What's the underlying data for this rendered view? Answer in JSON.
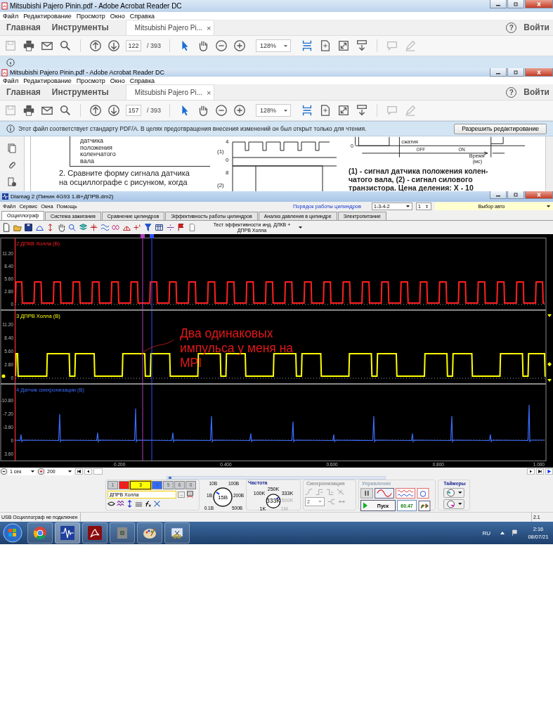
{
  "acrobat_windows": [
    {
      "title": "Mitsubishi Pajero Pinin.pdf - Adobe Acrobat Reader DC",
      "menu": [
        "Файл",
        "Редактирование",
        "Просмотр",
        "Окно",
        "Справка"
      ],
      "nav_tabs": [
        "Главная",
        "Инструменты"
      ],
      "document_tab": "Mitsubishi Pajero Pi...",
      "close_tab": "×",
      "help": "?",
      "sign_in": "Войти",
      "page": "122",
      "page_total": "/ 393",
      "zoom": "128%"
    },
    {
      "title": "Mitsubishi Pajero Pinin.pdf - Adobe Acrobat Reader DC",
      "menu": [
        "Файл",
        "Редактирование",
        "Просмотр",
        "Окно",
        "Справка"
      ],
      "nav_tabs": [
        "Главная",
        "Инструменты"
      ],
      "document_tab": "Mitsubishi Pajero Pi...",
      "close_tab": "×",
      "help": "?",
      "sign_in": "Войти",
      "page": "157",
      "page_total": "/ 393",
      "zoom": "128%",
      "info_bar": {
        "text": "Этот файл соответствует стандарту PDF/A. В целях предотвращения внесения изменений он был открыт только для чтения.",
        "button": "Разрешить редактирование"
      },
      "document": {
        "callout": [
          "датчика",
          "положения",
          "коленчатого",
          "вала"
        ],
        "paragraph": [
          "2. Сравните форму сигнала датчика",
          "на осциллографе с рисунком, когда"
        ],
        "middle_labels": [
          "4",
          "(1)",
          "0",
          "8",
          "(2)"
        ],
        "right_labels": {
          "compression": "сжатия",
          "zero": "0",
          "off": "OFF",
          "on": "ON",
          "axis_title": "Время",
          "axis_unit": "(мс)"
        },
        "caption": [
          "(1) - сигнал датчика положения колен-",
          "чатого вала, (2) - сигнал силового",
          "транзистора. Цена деления: X - 10"
        ]
      }
    }
  ],
  "diamag": {
    "title": "Diamag 2 (Пинин 4G93 1.8l+ДПРВ.dm2)",
    "menu": [
      "Файл",
      "Сервис",
      "Окна",
      "Помощь"
    ],
    "cylinder_order_label": "Порядок работы цилиндров",
    "cylinder_order": "1-3-4-2",
    "cylinder": "1",
    "car_select": "Выбор авто",
    "tabs": [
      {
        "label": "Осциллограф",
        "selected": true
      },
      {
        "label": "Система зажигания",
        "selected": false
      },
      {
        "label": "Сравнение цилиндров",
        "selected": false
      },
      {
        "label": "Эффективность работы цилиндров",
        "selected": false
      },
      {
        "label": "Анализ давления в цилиндре",
        "selected": false
      },
      {
        "label": "Электропитание",
        "selected": false
      }
    ],
    "test_select": "Тест эффективности инд. ДЛКВ + ДПРВ Холла",
    "channels": [
      {
        "label": "2 ДПКВ Холла (В)",
        "color": "#ff2020",
        "kind": "square",
        "yticks": [
          "11.20",
          "8.40",
          "5.60",
          "2.80",
          "0"
        ]
      },
      {
        "label": "3 ДПРВ Холла (В)",
        "color": "#ffff00",
        "kind": "cam",
        "yticks": [
          "11.20",
          "8.40",
          "5.60",
          "2.80",
          "0"
        ]
      },
      {
        "label": "4 Датчик синхронизации (В)",
        "color": "#3a6bff",
        "kind": "spikes",
        "yticks": [
          "-10.80",
          "-7.20",
          "-3.60",
          "0",
          "3.60"
        ]
      }
    ],
    "xticks": [
      "0.200",
      "0.400",
      "0.600",
      "0.800",
      "1.000"
    ],
    "annotation": "Два одинаковых импульса у меня на MPI",
    "timebase": "1 сек",
    "points": "200",
    "channel_buttons": [
      {
        "label": "1",
        "color": "#c8ccd0",
        "selected": false
      },
      {
        "label": "2",
        "color": "#ff1a1a",
        "selected": false
      },
      {
        "label": "3",
        "color": "#ffff00",
        "selected": true
      },
      {
        "label": "4",
        "color": "#2f6bff",
        "selected": false
      },
      {
        "label": "5",
        "color": "#c8ccd0",
        "selected": false
      },
      {
        "label": "6",
        "color": "#c8ccd0",
        "selected": false
      },
      {
        "label": "0",
        "color": "#c8ccd0",
        "selected": false
      }
    ],
    "channel_name": "ДПРВ Холла",
    "more": "...",
    "volts_knob": {
      "labels": [
        "10В",
        "100В",
        "1В",
        "200В",
        "0.1В",
        "500В"
      ],
      "value": "15В"
    },
    "frequency": {
      "title": "Частота",
      "labels": [
        "250K",
        "100K",
        "333K",
        "500K",
        "1K",
        "1M"
      ],
      "value": "333K"
    },
    "sync": {
      "title": "Синхронизация",
      "channel": "2"
    },
    "control": {
      "title": "Управление",
      "start": "Пуск",
      "rate": "60.47"
    },
    "timers": {
      "title": "Таймеры"
    },
    "status": "USB Осциллограф не подключен",
    "version": "2.1"
  },
  "taskbar": {
    "language": "RU",
    "time": "2:16",
    "date": "08/07/21"
  }
}
